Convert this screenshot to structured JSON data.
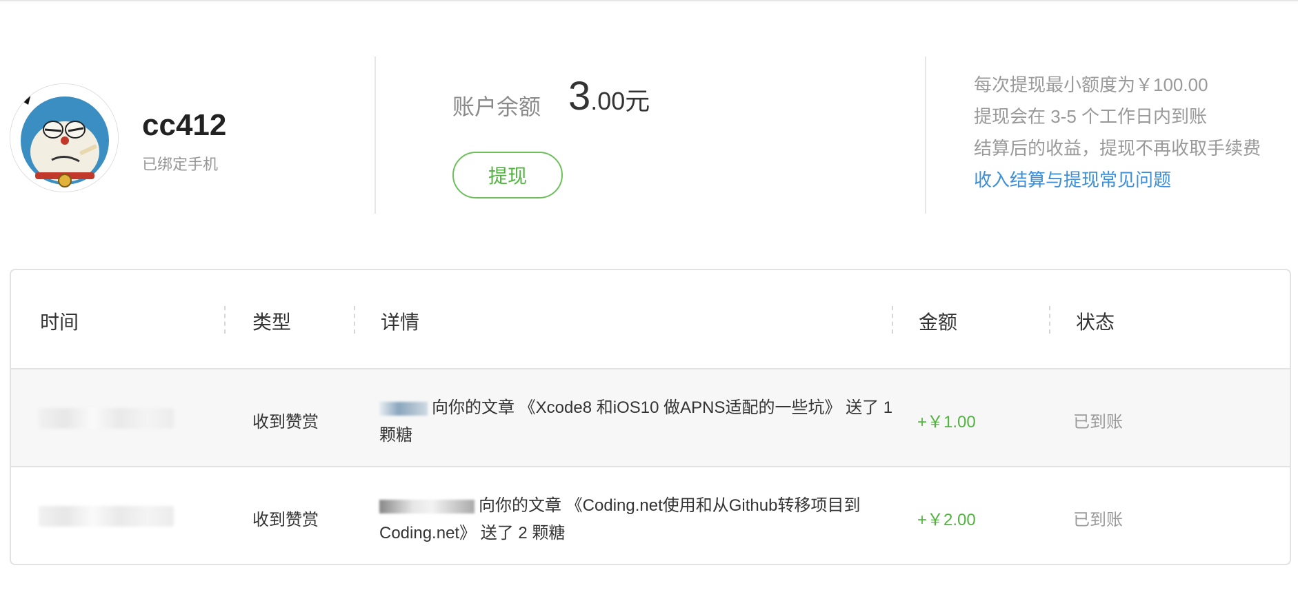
{
  "profile": {
    "username": "cc412",
    "phone_status": "已绑定手机",
    "avatar_icon": "doraemon-avatar-icon"
  },
  "balance": {
    "label": "账户余额",
    "amount_int": "3",
    "amount_dec": ".00元",
    "withdraw_label": "提现"
  },
  "notes": {
    "line1": "每次提现最小额度为￥100.00",
    "line2": "提现会在 3-5 个工作日内到账",
    "line3": "结算后的收益，提现不再收取手续费",
    "faq_link": "收入结算与提现常见问题"
  },
  "table": {
    "headers": [
      "时间",
      "类型",
      "详情",
      "金额",
      "状态"
    ],
    "rows": [
      {
        "time": "",
        "type": "收到赞赏",
        "detail_line1": "向你的文章 《Xcode8 和iOS10 做APNS适配的一些坑》 送了 1",
        "detail_line2": "颗糖",
        "amount": "+￥1.00",
        "status": "已到账"
      },
      {
        "time": "",
        "type": "收到赞赏",
        "detail_line1": "向你的文章 《Coding.net使用和从Github转移项目到",
        "detail_line2": "Coding.net》 送了 2 颗糖",
        "amount": "+￥2.00",
        "status": "已到账"
      }
    ]
  },
  "colors": {
    "accent_green": "#52b340",
    "link_blue": "#3d8fd6",
    "muted_gray": "#999999"
  }
}
